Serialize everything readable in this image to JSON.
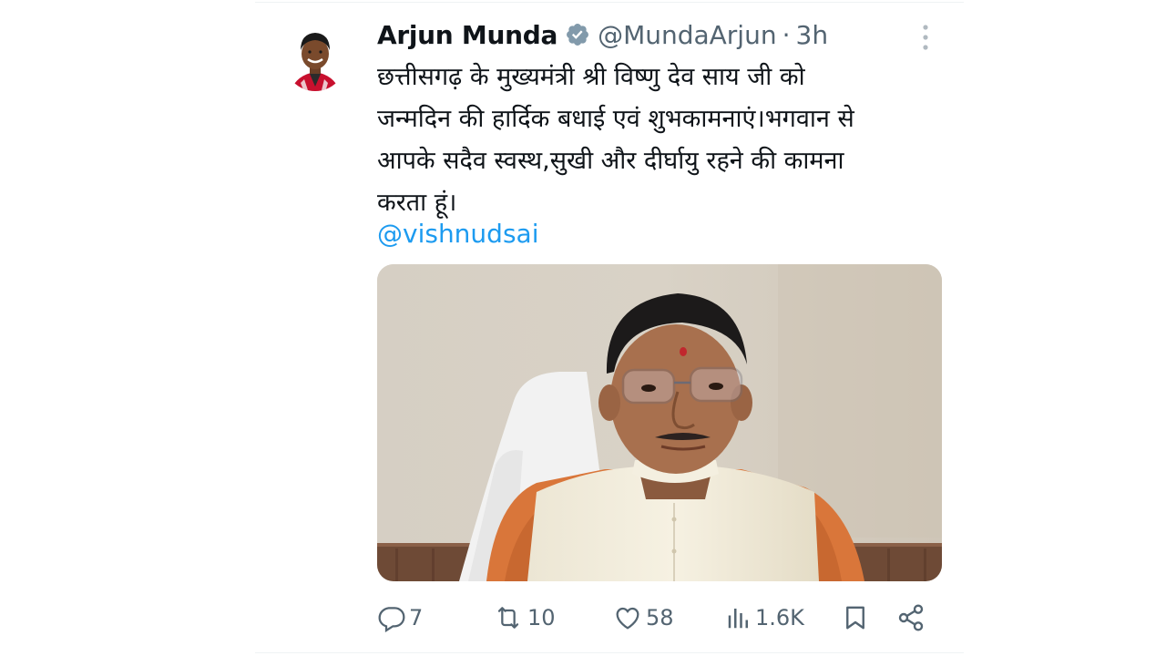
{
  "tweet": {
    "author": {
      "display_name": "Arjun Munda",
      "handle": "@MundaArjun",
      "separator": "·",
      "time": "3h",
      "verified_icon": "verified-badge-icon"
    },
    "text_lines": [
      "छत्तीसगढ़ के मुख्यमंत्री श्री विष्णु देव साय जी को",
      "जन्मदिन की हार्दिक बधाई एवं शुभकामनाएं।भगवान से",
      "आपके सदैव स्वस्थ,सुखी और दीर्घायु रहने की कामना",
      "करता हूं।"
    ],
    "mention": "@vishnudsai",
    "actions": {
      "reply": {
        "icon": "reply-icon",
        "count": "7"
      },
      "retweet": {
        "icon": "retweet-icon",
        "count": "10"
      },
      "like": {
        "icon": "heart-icon",
        "count": "58"
      },
      "views": {
        "icon": "views-icon",
        "count": "1.6K"
      },
      "bookmark": {
        "icon": "bookmark-icon"
      },
      "share": {
        "icon": "share-icon"
      }
    },
    "colors": {
      "text": "#0f1419",
      "secondary": "#536471",
      "link": "#1d9bf0"
    }
  }
}
